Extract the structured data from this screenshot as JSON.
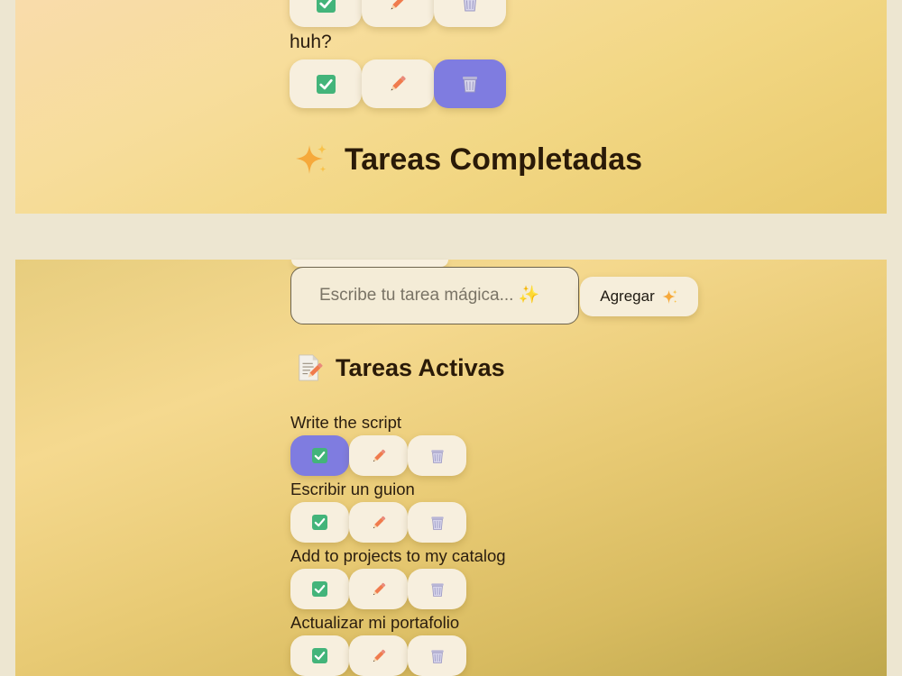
{
  "completed_panel": {
    "task": {
      "label": "huh?"
    },
    "section_title": "Tareas Completadas",
    "section_icon": "sparkles-icon"
  },
  "active_panel": {
    "input": {
      "placeholder": "Escribe tu tarea mágica... ✨",
      "value": ""
    },
    "add_button": {
      "label": "Agregar",
      "icon": "sparkles-icon"
    },
    "section_title": "Tareas Activas",
    "section_icon": "memo-icon",
    "tasks": [
      {
        "label": "Write the script"
      },
      {
        "label": "Escribir un guion"
      },
      {
        "label": "Add to projects to my catalog"
      },
      {
        "label": "Actualizar mi portafolio"
      }
    ]
  },
  "colors": {
    "page_background": "#ede6d1",
    "button_background": "#f7efde",
    "button_active": "#7f7ce0",
    "check_green": "#43b47a",
    "text": "#2a1d0f"
  }
}
